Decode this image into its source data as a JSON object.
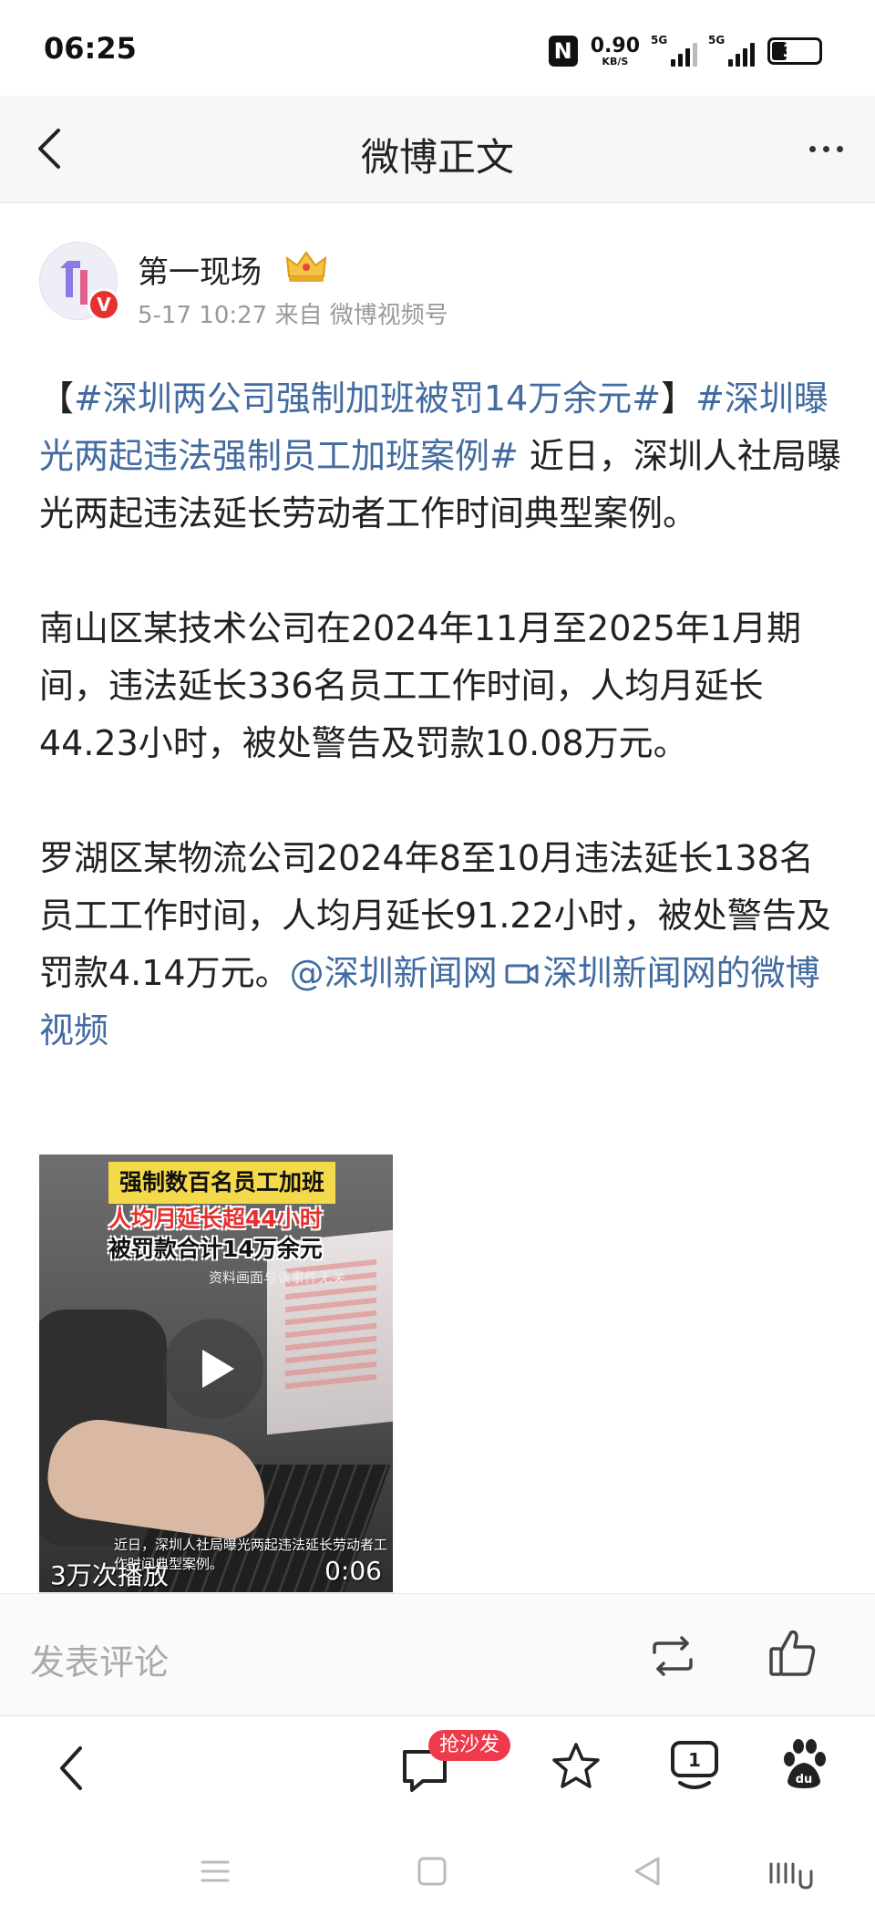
{
  "status_bar": {
    "time": "06:25",
    "nfc": "N",
    "net_speed": "0.90",
    "net_unit": "KB/S",
    "signal1_label": "5G",
    "signal2_label": "5G",
    "battery": "31"
  },
  "header": {
    "title": "微博正文",
    "back_icon": "chevron-left-icon",
    "more_icon": "more-dots-icon"
  },
  "author": {
    "name": "第一现场",
    "verified_badge": "V",
    "meta": "5-17 10:27 来自 微博视频号"
  },
  "post": {
    "p1": {
      "bracket_open": "【",
      "tag1": "#深圳两公司强制加班被罚14万余元#",
      "bracket_close": "】",
      "tag2": "#深圳曝光两起违法强制员工加班案例#",
      "text": " 近日，深圳人社局曝光两起违法延长劳动者工作时间典型案例。"
    },
    "p2": "南山区某技术公司在2024年11月至2025年1月期间，违法延长336名员工工作时间，人均月延长44.23小时，被处警告及罚款10.08万元。",
    "p3": {
      "text": "罗湖区某物流公司2024年8至10月违法延长138名员工工作时间，人均月延长91.22小时，被处警告及罚款4.14万元。",
      "mention": "@深圳新闻网",
      "video_link": "深圳新闻网的微博视频"
    }
  },
  "video": {
    "caption1": "强制数百名员工加班",
    "caption2": "人均月延长超44小时",
    "caption3": "被罚款合计14万余元",
    "caption4": "资料画面与该事件无关",
    "subtitle": "近日，深圳人社局曝光两起违法延长劳动者工作时间典型案例。",
    "views": "3万次播放",
    "duration": "0:06"
  },
  "comment_bar": {
    "placeholder": "发表评论"
  },
  "bottom_nav": {
    "sofa_badge": "抢沙发"
  },
  "colors": {
    "link": "#426ba0",
    "badge_red": "#ee3b4b",
    "header_bg": "#f7f7f7"
  }
}
